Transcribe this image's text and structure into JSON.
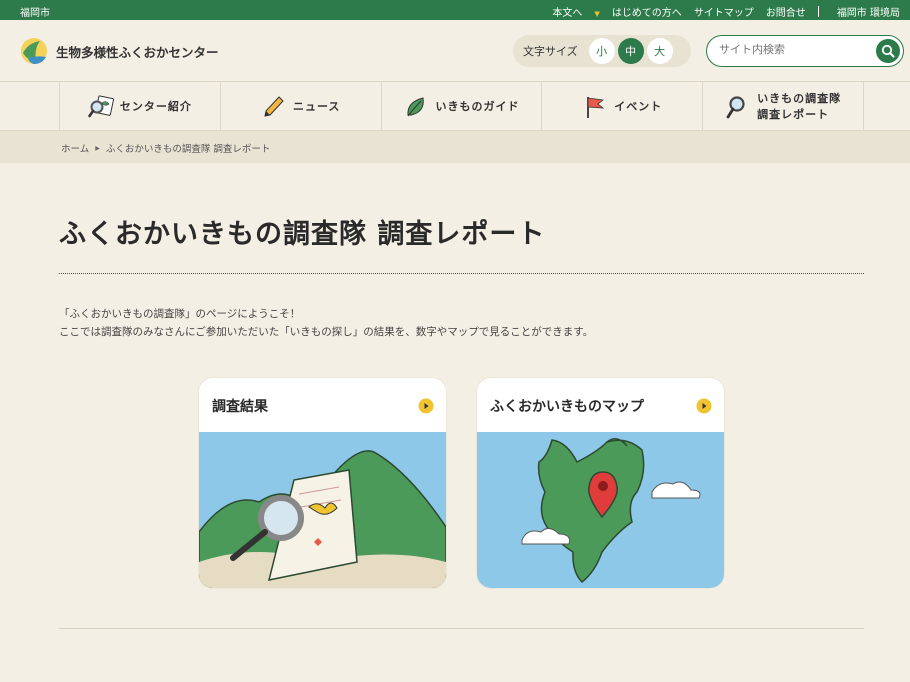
{
  "topbar": {
    "city": "福岡市",
    "links": [
      "本文へ",
      "はじめての方へ",
      "サイトマップ",
      "お問合せ"
    ],
    "bureau": "福岡市 環境局"
  },
  "header": {
    "site_name": "生物多様性ふくおかセンター",
    "font_size": {
      "label": "文字サイズ",
      "small": "小",
      "medium": "中",
      "large": "大",
      "selected": "中"
    },
    "search": {
      "placeholder": "サイト内検索"
    }
  },
  "nav": {
    "items": [
      {
        "label": "センター紹介",
        "icon": "magnifier-leaf-icon"
      },
      {
        "label": "ニュース",
        "icon": "pencil-icon"
      },
      {
        "label": "いきものガイド",
        "icon": "leaf-icon"
      },
      {
        "label": "イベント",
        "icon": "flag-icon"
      },
      {
        "label_line1": "いきもの調査隊",
        "label_line2": "調査レポート",
        "icon": "magnifier-icon"
      }
    ]
  },
  "breadcrumb": {
    "home": "ホーム",
    "current": "ふくおかいきもの調査隊 調査レポート"
  },
  "page": {
    "title": "ふくおかいきもの調査隊 調査レポート",
    "intro_line1": "「ふくおかいきもの調査隊」のページにようこそ！",
    "intro_line2": "ここでは調査隊のみなさんにご参加いただいた「いきもの探し」の結果を、数字やマップで見ることができます。"
  },
  "cards": [
    {
      "title": "調査結果"
    },
    {
      "title": "ふくおかいきものマップ"
    }
  ],
  "colors": {
    "brand_green": "#2d7a4a",
    "background": "#f4efe4",
    "accent_yellow": "#f0c330"
  }
}
